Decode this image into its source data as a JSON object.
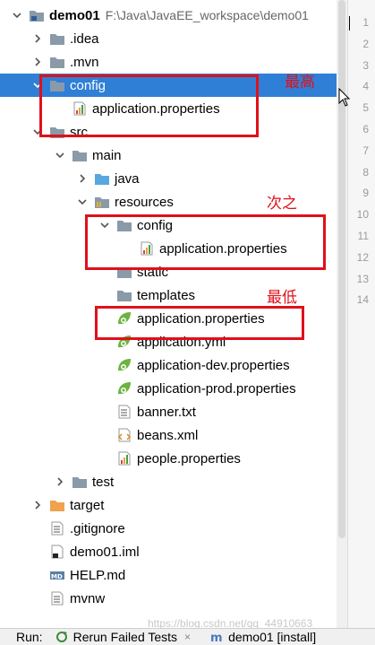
{
  "tree": {
    "items": [
      {
        "label": "demo01",
        "path": "F:\\Java\\JavaEE_workspace\\demo01",
        "arrow": "down",
        "icon": "module-folder-icon",
        "bold": true
      },
      {
        "label": ".idea",
        "arrow": "right",
        "icon": "folder-icon"
      },
      {
        "label": ".mvn",
        "arrow": "right",
        "icon": "folder-icon"
      },
      {
        "label": "config",
        "arrow": "down",
        "icon": "folder-icon",
        "selected": true
      },
      {
        "label": "application.properties",
        "arrow": "none",
        "icon": "properties-icon"
      },
      {
        "label": "src",
        "arrow": "down",
        "icon": "folder-icon"
      },
      {
        "label": "main",
        "arrow": "down",
        "icon": "folder-icon"
      },
      {
        "label": "java",
        "arrow": "right",
        "icon": "source-folder-icon"
      },
      {
        "label": "resources",
        "arrow": "down",
        "icon": "resources-folder-icon"
      },
      {
        "label": "config",
        "arrow": "down",
        "icon": "folder-icon"
      },
      {
        "label": "application.properties",
        "arrow": "none",
        "icon": "properties-icon"
      },
      {
        "label": "static",
        "arrow": "none",
        "icon": "folder-icon"
      },
      {
        "label": "templates",
        "arrow": "none",
        "icon": "folder-icon"
      },
      {
        "label": "application.properties",
        "arrow": "none",
        "icon": "spring-leaf-icon"
      },
      {
        "label": "application.yml",
        "arrow": "none",
        "icon": "spring-leaf-icon"
      },
      {
        "label": "application-dev.properties",
        "arrow": "none",
        "icon": "spring-leaf-icon"
      },
      {
        "label": "application-prod.properties",
        "arrow": "none",
        "icon": "spring-leaf-icon"
      },
      {
        "label": "banner.txt",
        "arrow": "none",
        "icon": "text-file-icon"
      },
      {
        "label": "beans.xml",
        "arrow": "none",
        "icon": "xml-file-icon"
      },
      {
        "label": "people.properties",
        "arrow": "none",
        "icon": "properties-icon"
      },
      {
        "label": "test",
        "arrow": "right",
        "icon": "folder-icon"
      },
      {
        "label": "target",
        "arrow": "right",
        "icon": "excluded-folder-icon"
      },
      {
        "label": ".gitignore",
        "arrow": "none",
        "icon": "text-file-icon"
      },
      {
        "label": "demo01.iml",
        "arrow": "none",
        "icon": "iml-file-icon"
      },
      {
        "label": "HELP.md",
        "arrow": "none",
        "icon": "markdown-file-icon"
      },
      {
        "label": "mvnw",
        "arrow": "none",
        "icon": "text-file-icon"
      }
    ]
  },
  "gutter": {
    "lines": [
      "1",
      "2",
      "3",
      "4",
      "5",
      "6",
      "7",
      "8",
      "9",
      "10",
      "11",
      "12",
      "13",
      "14"
    ]
  },
  "annotations": {
    "highest": "最高",
    "second": "次之",
    "lowest": "最低"
  },
  "bottom_bar": {
    "run_label": "Run:",
    "rerun_label": "Rerun Failed Tests",
    "close_glyph": "×",
    "run_config_label": "demo01 [install]"
  },
  "watermark": "https://blog.csdn.net/qq_44910663",
  "colors": {
    "selection": "#2f7fd6",
    "annotation": "#e0101a",
    "folder": "#8a9aa8",
    "source_folder": "#5aa7e0",
    "excluded_folder": "#f0a24d",
    "spring": "#6db33f"
  }
}
